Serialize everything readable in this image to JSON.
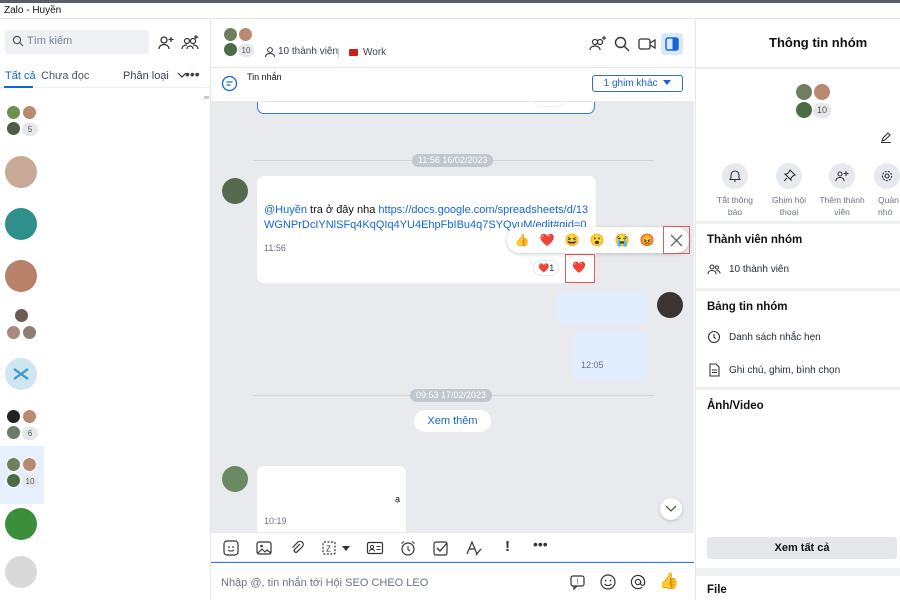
{
  "window": {
    "title": "Zalo - Huyền"
  },
  "sidebar": {
    "search_placeholder": "Tìm kiếm",
    "tabs": {
      "all": "Tất cả",
      "unread": "Chưa đọc",
      "classify": "Phân loại"
    },
    "conversations": [
      {
        "type": "group",
        "count": "5"
      },
      {
        "type": "avatar",
        "color": "#c9a896"
      },
      {
        "type": "avatar",
        "color": "#2f8f8a"
      },
      {
        "type": "avatar",
        "color": "#b9816a"
      },
      {
        "type": "group",
        "count": ""
      },
      {
        "type": "avatar",
        "color": "#cfe6f0"
      },
      {
        "type": "group",
        "count": "6"
      },
      {
        "type": "group",
        "count": "10",
        "selected": true
      },
      {
        "type": "avatar",
        "color": "#3b8f3b"
      },
      {
        "type": "avatar",
        "color": "#d9d9d9"
      }
    ]
  },
  "chat": {
    "member_count": "10",
    "members_label": "10 thành viên",
    "tag_label": "Work",
    "pinned_label": "Tin nhắn",
    "pinned_more": "1 ghim khác",
    "date1": "11:56 16/02/2023",
    "message1": {
      "mention": "@Huyền",
      "text": " tra ở đây nha ",
      "link": "https://docs.google.com/spreadsheets/d/13WGNPrDcIYNlSFq4KqQIq4YU4EhpFbIBu4q7SYQvuM/edit#gid=0",
      "time": "11:56"
    },
    "reaction_count": "1",
    "my_time": "12:05",
    "date2": "09:53 17/02/2023",
    "see_more": "Xem thêm",
    "last_fragment": "ạ",
    "last_time": "10:19",
    "composer_placeholder": "Nhập @, tin nhắn tới Hội SEO CHEO LEO"
  },
  "right_panel": {
    "title": "Thông tin nhóm",
    "member_count": "10",
    "actions": [
      "Tắt thông báo",
      "Ghim hội thoại",
      "Thêm thành viên",
      "Quản nhó"
    ],
    "members_section": "Thành viên nhóm",
    "members_row": "10 thành viên",
    "board_section": "Bảng tin nhóm",
    "board_rows": [
      "Danh sách nhắc hẹn",
      "Ghi chú, ghim, bình chọn"
    ],
    "media_section": "Ảnh/Video",
    "see_all": "Xem tất cả",
    "file_section": "File"
  },
  "colors": {
    "accent": "#1565d8",
    "highlight_box": "#e25a5a",
    "tag": "#d21b1b"
  }
}
